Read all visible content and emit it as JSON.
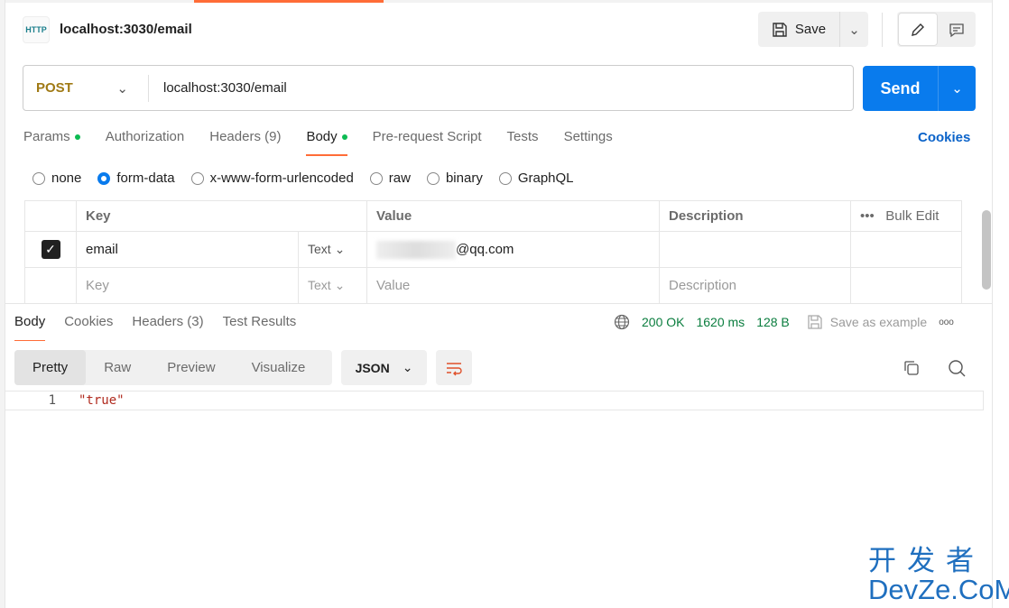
{
  "header": {
    "title": "localhost:3030/email",
    "icon_label": "HTTP",
    "save_label": "Save"
  },
  "request": {
    "method": "POST",
    "url": "localhost:3030/email",
    "send_label": "Send"
  },
  "tabs": [
    {
      "label": "Params",
      "dot": true
    },
    {
      "label": "Authorization"
    },
    {
      "label": "Headers (9)"
    },
    {
      "label": "Body",
      "dot": true,
      "active": true
    },
    {
      "label": "Pre-request Script"
    },
    {
      "label": "Tests"
    },
    {
      "label": "Settings"
    }
  ],
  "cookies_label": "Cookies",
  "body_modes": [
    {
      "label": "none"
    },
    {
      "label": "form-data",
      "selected": true
    },
    {
      "label": "x-www-form-urlencoded"
    },
    {
      "label": "raw"
    },
    {
      "label": "binary"
    },
    {
      "label": "GraphQL"
    }
  ],
  "params_table": {
    "headers": {
      "key": "Key",
      "value": "Value",
      "description": "Description",
      "bulk_edit": "Bulk Edit"
    },
    "rows": [
      {
        "checked": true,
        "key": "email",
        "type": "Text",
        "value": "@qq.com",
        "description": ""
      }
    ],
    "placeholder": {
      "key": "Key",
      "type": "Text",
      "value": "Value",
      "description": "Description"
    }
  },
  "response": {
    "tabs": [
      "Body",
      "Cookies",
      "Headers (3)",
      "Test Results"
    ],
    "status": "200 OK",
    "time": "1620 ms",
    "size": "128 B",
    "save_example": "Save as example",
    "views": [
      "Pretty",
      "Raw",
      "Preview",
      "Visualize"
    ],
    "format": "JSON",
    "lines": [
      {
        "n": "1",
        "text": "\"true\""
      }
    ]
  },
  "watermark": {
    "zh": "开发者",
    "en": "DevZe.CoM"
  },
  "colors": {
    "accent": "#ff6c37",
    "send": "#097bed",
    "status": "#0a7d3e",
    "method": "#a07a15"
  }
}
